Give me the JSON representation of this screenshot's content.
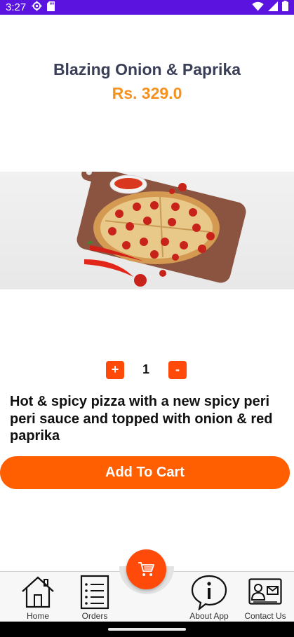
{
  "status_bar": {
    "time": "3:27",
    "icons": [
      "gear-icon",
      "sd-card-icon",
      "wifi-icon",
      "signal-icon",
      "battery-icon"
    ]
  },
  "product": {
    "name": "Blazing Onion & Paprika",
    "price": "Rs. 329.0",
    "description": "Hot & spicy pizza with a new spicy peri peri sauce and topped with onion & red paprika",
    "image": "pizza-photo"
  },
  "stepper": {
    "plus_label": "+",
    "quantity": "1",
    "minus_label": "-"
  },
  "add_to_cart_label": "Add To Cart",
  "bottom_nav": {
    "home": "Home",
    "orders": "Orders",
    "about": "About App",
    "contact": "Contact Us"
  },
  "colors": {
    "status_bar": "#5b13e0",
    "accent": "#ff5f00",
    "price": "#f5911f",
    "title": "#3a3f57"
  }
}
